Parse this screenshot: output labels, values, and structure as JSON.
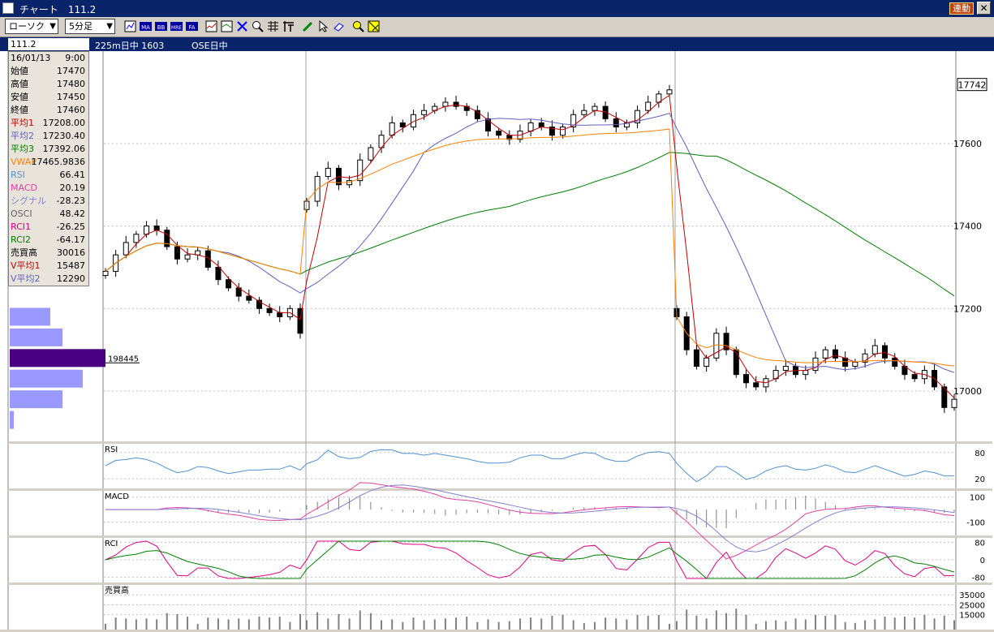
{
  "window": {
    "title": "チャート　111.2",
    "link_label": "連動",
    "close_label": "✕"
  },
  "toolbar": {
    "chart_type": "ローソク",
    "interval": "5分足"
  },
  "infobar": {
    "code": "111.2",
    "instrument": "225m日中 1603",
    "market": "OSE日中"
  },
  "price_label": "17742",
  "volume_profile_label": "198445",
  "info_panel": [
    {
      "label": "16/01/13",
      "value": "9:00",
      "color": "#000000"
    },
    {
      "label": "始値",
      "value": "17470",
      "color": "#000000"
    },
    {
      "label": "高値",
      "value": "17480",
      "color": "#000000"
    },
    {
      "label": "安値",
      "value": "17450",
      "color": "#000000"
    },
    {
      "label": "終値",
      "value": "17460",
      "color": "#000000"
    },
    {
      "label": "平均1",
      "value": "17208.00",
      "color": "#c00000"
    },
    {
      "label": "平均2",
      "value": "17230.40",
      "color": "#6060c0"
    },
    {
      "label": "平均3",
      "value": "17392.06",
      "color": "#008000"
    },
    {
      "label": "VWAP",
      "value": "17465.9836",
      "color": "#ff8000"
    },
    {
      "label": "RSI",
      "value": "66.41",
      "color": "#5090d0"
    },
    {
      "label": "MACD",
      "value": "20.19",
      "color": "#e040a0"
    },
    {
      "label": "シグナル",
      "value": "-28.23",
      "color": "#8080d0"
    },
    {
      "label": "OSCI",
      "value": "48.42",
      "color": "#606060"
    },
    {
      "label": "RCI1",
      "value": "-26.25",
      "color": "#e00080"
    },
    {
      "label": "RCI2",
      "value": "-64.17",
      "color": "#008000"
    },
    {
      "label": "売買高",
      "value": "30016",
      "color": "#000000"
    },
    {
      "label": "V平均1",
      "value": "15487",
      "color": "#c00000"
    },
    {
      "label": "V平均2",
      "value": "12290",
      "color": "#6060c0"
    }
  ],
  "colors": {
    "ma1": "#c00000",
    "ma2": "#6060c0",
    "ma3": "#008000",
    "vwap": "#ff8000",
    "rsi": "#5090d0",
    "macd": "#e040a0",
    "signal": "#8080d0",
    "rci1": "#e00080",
    "rci2": "#008000",
    "profile": "#9999ff",
    "profile_max": "#4b0082"
  },
  "chart_data": {
    "type": "candlestick",
    "price_axis": {
      "ylim": [
        16880,
        17820
      ],
      "ticks": [
        17000,
        17200,
        17400,
        17600
      ]
    },
    "rsi_axis": {
      "ticks": [
        80,
        20
      ],
      "ylim": [
        0,
        100
      ]
    },
    "macd_axis": {
      "ticks": [
        100,
        -100
      ],
      "ylim": [
        -200,
        150
      ]
    },
    "rci_axis": {
      "ticks": [
        80,
        0,
        -80
      ],
      "ylim": [
        -100,
        100
      ]
    },
    "volume_axis": {
      "ticks": [
        35000,
        25000,
        15000
      ],
      "ylim": [
        0,
        45000
      ]
    },
    "panel_labels": {
      "rsi": "RSI",
      "macd": "MACD",
      "rci": "RCI",
      "volume": "売買高"
    },
    "segments": [
      {
        "close": [
          17290,
          17330,
          17360,
          17380,
          17400,
          17390,
          17350,
          17320,
          17330,
          17340,
          17300,
          17270,
          17250,
          17230,
          17220,
          17200,
          17190,
          17180,
          17200,
          17140
        ],
        "open_first": 17280
      },
      {
        "close": [
          17460,
          17520,
          17540,
          17500,
          17510,
          17560,
          17590,
          17620,
          17650,
          17640,
          17670,
          17680,
          17690,
          17700,
          17690,
          17680,
          17660,
          17630,
          17620,
          17610,
          17630,
          17650,
          17640,
          17620,
          17640,
          17670,
          17680,
          17690,
          17660,
          17640,
          17650,
          17680,
          17700,
          17720,
          17730
        ],
        "open_first": 17440
      },
      {
        "close": [
          17180,
          17100,
          17060,
          17080,
          17140,
          17100,
          17040,
          17020,
          17010,
          17030,
          17050,
          17060,
          17040,
          17050,
          17080,
          17100,
          17080,
          17060,
          17070,
          17090,
          17110,
          17080,
          17060,
          17040,
          17030,
          17050,
          17010,
          16960,
          16980
        ],
        "open_first": 17200
      }
    ]
  }
}
